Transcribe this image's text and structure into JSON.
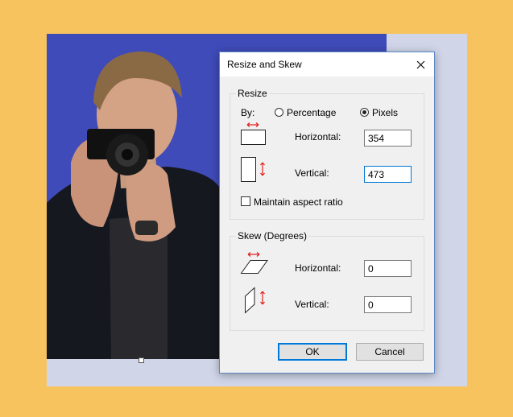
{
  "dialog": {
    "title": "Resize and Skew",
    "close_icon": "close-icon",
    "resize": {
      "legend": "Resize",
      "by_label": "By:",
      "percentage_label": "Percentage",
      "pixels_label": "Pixels",
      "selected_mode": "Pixels",
      "horizontal_label": "Horizontal:",
      "horizontal_value": "354",
      "vertical_label": "Vertical:",
      "vertical_value": "473",
      "maintain_label": "Maintain aspect ratio",
      "maintain_checked": false
    },
    "skew": {
      "legend": "Skew (Degrees)",
      "horizontal_label": "Horizontal:",
      "horizontal_value": "0",
      "vertical_label": "Vertical:",
      "vertical_value": "0"
    },
    "ok_label": "OK",
    "cancel_label": "Cancel"
  },
  "colors": {
    "background": "#f7c35f",
    "canvas": "#d0d6e8",
    "photo_backdrop": "#3f4bb8",
    "arrow": "#e02020",
    "focus": "#0078d7"
  }
}
